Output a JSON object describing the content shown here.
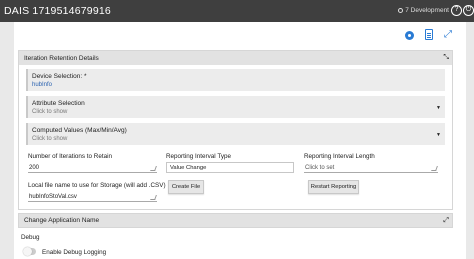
{
  "topbar": {
    "title": "DAIS 1719514679916",
    "environment": "7 Development",
    "icons": [
      "help-icon",
      "power-icon"
    ]
  },
  "toolbar_icons": [
    "gear-icon",
    "document-icon",
    "expand-icon"
  ],
  "retention_card": {
    "header": "Iteration Retention Details",
    "device_selection": {
      "label": "Device Selection: *",
      "value": "hubInfo"
    },
    "attribute_selection": {
      "label": "Attribute Selection",
      "hint": "Click to show"
    },
    "computed_values": {
      "label": "Computed Values (Max/Min/Avg)",
      "hint": "Click to show"
    },
    "iterations": {
      "label": "Number of Iterations to Retain",
      "value": "200"
    },
    "reporting_type": {
      "label": "Reporting Interval Type",
      "value": "Value Change"
    },
    "reporting_length": {
      "label": "Reporting Interval Length",
      "placeholder": "Click to set"
    },
    "storage_file": {
      "label": "Local file name to use for Storage (will add .CSV)",
      "value": "hubInfoStoVal.csv"
    },
    "create_file_button": "Create File",
    "restart_button": "Restart Reporting"
  },
  "app_name_card": {
    "header": "Change Application Name"
  },
  "debug": {
    "label": "Debug",
    "toggle_label": "Enable Debug Logging",
    "enabled": false
  }
}
